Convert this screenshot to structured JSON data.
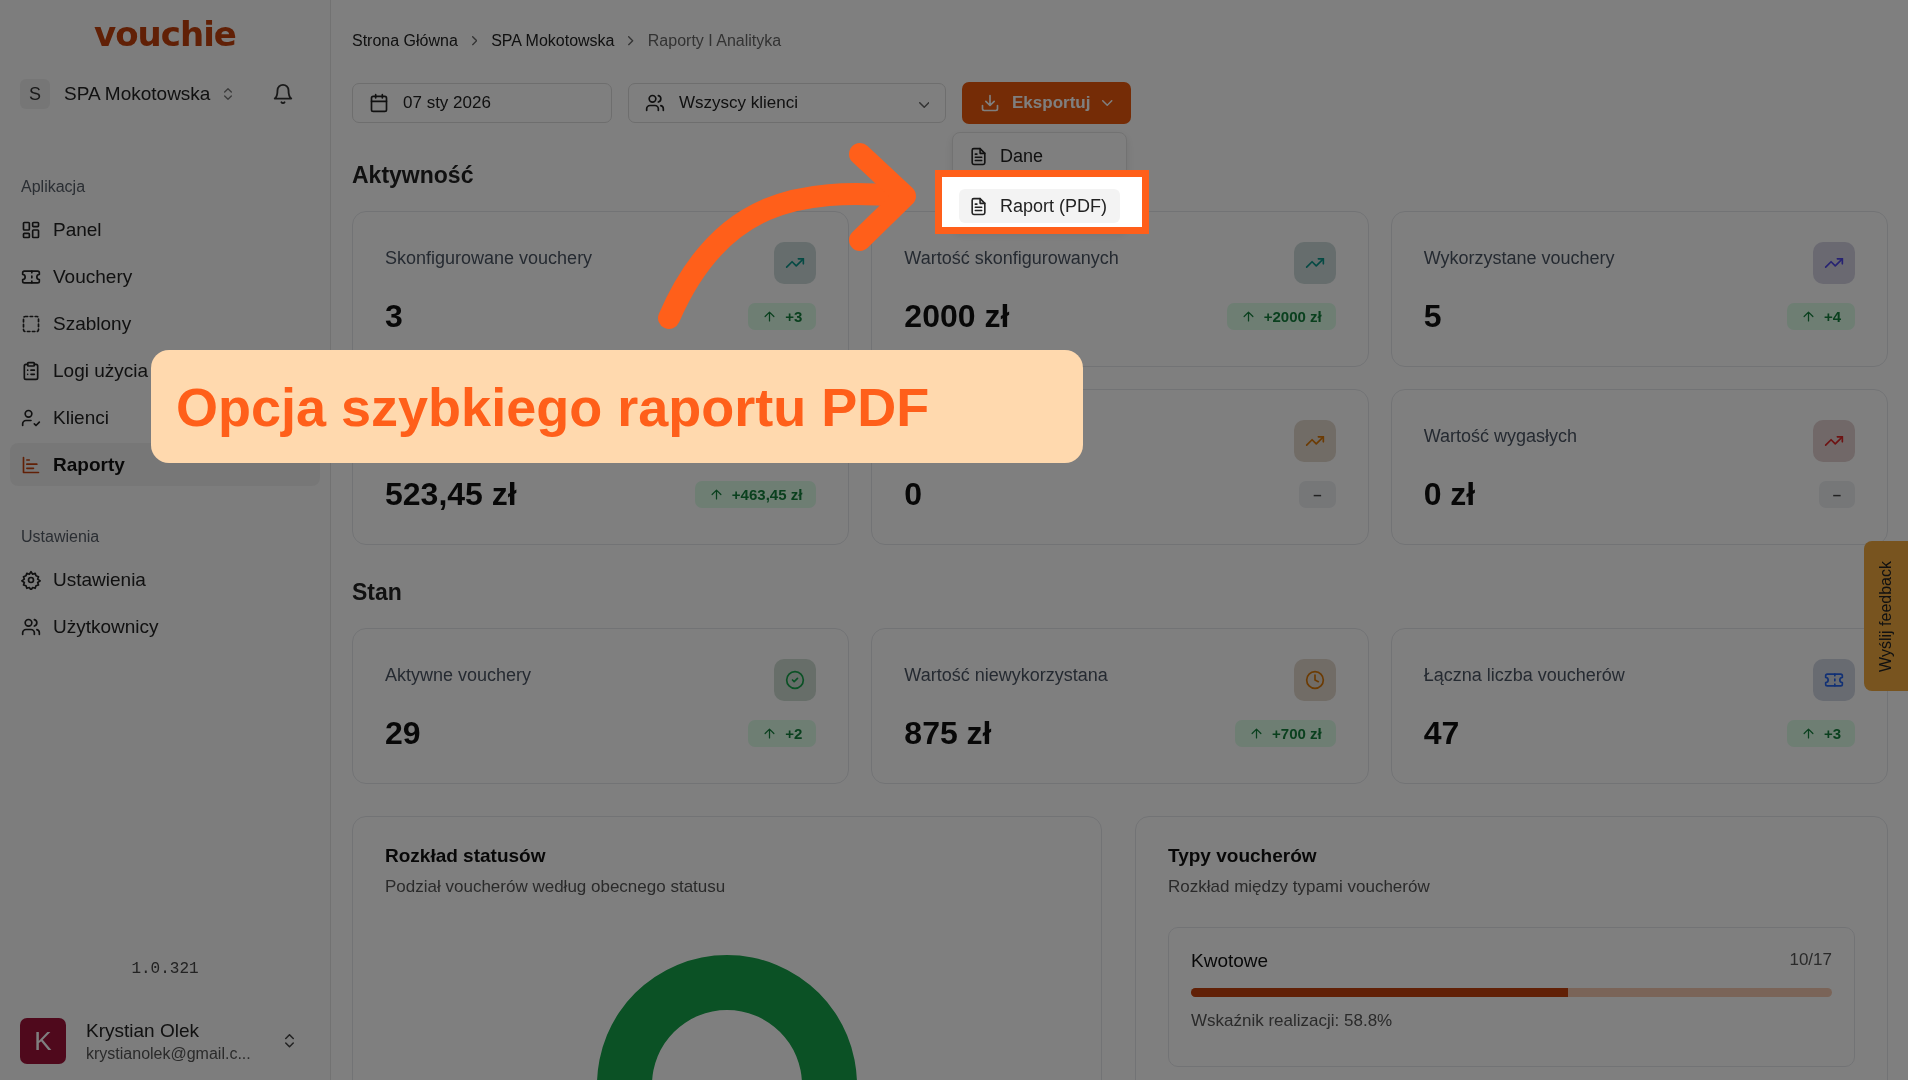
{
  "sidebar": {
    "logo": "vouchie",
    "workspace": {
      "initial": "S",
      "name": "SPA Mokotowska"
    },
    "sections": [
      {
        "title": "Aplikacja",
        "items": [
          {
            "label": "Panel",
            "kind": "grid",
            "selected": false
          },
          {
            "label": "Vouchery",
            "kind": "ticket",
            "selected": false
          },
          {
            "label": "Szablony",
            "kind": "template",
            "selected": false
          },
          {
            "label": "Logi użycia",
            "kind": "log",
            "selected": false
          },
          {
            "label": "Klienci",
            "kind": "client",
            "selected": false
          },
          {
            "label": "Raporty",
            "kind": "report",
            "selected": true
          }
        ]
      },
      {
        "title": "Ustawienia",
        "items": [
          {
            "label": "Ustawienia",
            "kind": "settings",
            "selected": false
          },
          {
            "label": "Użytkownicy",
            "kind": "users",
            "selected": false
          }
        ]
      }
    ],
    "version": "1.0.321",
    "user": {
      "initial": "K",
      "name": "Krystian Olek",
      "email": "krystianolek@gmail.c..."
    }
  },
  "breadcrumb": [
    "Strona Główna",
    "SPA Mokotowska",
    "Raporty I Analityka"
  ],
  "toolbar": {
    "date": "07 sty 2026",
    "clients": "Wszyscy klienci",
    "export": "Eksportuj",
    "export_menu": [
      {
        "label": "Dane",
        "highlighted": false
      },
      {
        "label": "Raport (PDF)",
        "highlighted": true
      }
    ]
  },
  "sections": [
    {
      "title": "Aktywność",
      "cards": [
        {
          "label": "Skonfigurowane vouchery",
          "value": "3",
          "kind": "trend",
          "color": "#064a44",
          "delta": {
            "text": "+3",
            "increase": true
          }
        },
        {
          "label": "Wartość skonfigurowanych",
          "value": "2000 zł",
          "kind": "trend",
          "color": "#064a44",
          "delta": {
            "text": "+2000 zł",
            "increase": true
          }
        },
        {
          "label": "Wykorzystane vouchery",
          "value": "5",
          "kind": "trend",
          "color": "#272372",
          "delta": {
            "text": "+4",
            "increase": true
          }
        },
        {
          "value": "523,45 zł",
          "delta": {
            "text": "+463,45 zł",
            "increase": true
          }
        },
        {
          "value": "0",
          "kind": "trend",
          "color": "#6c3b03",
          "delta": {
            "text": "–",
            "increase": false
          }
        },
        {
          "label": "Wartość wygasłych",
          "value": "0 zł",
          "kind": "trend",
          "color": "#6e1313",
          "delta": {
            "text": "–",
            "increase": false
          }
        }
      ]
    },
    {
      "title": "Stan",
      "cards": [
        {
          "label": "Aktywne vouchery",
          "value": "29",
          "kind": "check",
          "color": "#0b5125",
          "delta": {
            "text": "+2",
            "increase": true
          }
        },
        {
          "label": "Wartość niewykorzystana",
          "value": "875 zł",
          "kind": "clock",
          "color": "#6c3b03",
          "delta": {
            "text": "+700 zł",
            "increase": true
          }
        },
        {
          "label": "Łączna liczba voucherów",
          "value": "47",
          "kind": "ticket",
          "color": "#123175",
          "delta": {
            "text": "+3",
            "increase": true
          }
        }
      ]
    }
  ],
  "status_panel": {
    "title": "Rozkład statusów",
    "subtitle": "Podział voucherów według obecnego statusu"
  },
  "types_panel": {
    "title": "Typy voucherów",
    "subtitle": "Rozkład między typami voucherów",
    "items": [
      {
        "name": "Kwotowe",
        "count": "10/17",
        "level": 0.588,
        "caption": "Wskaźnik realizacji: 58.8%"
      }
    ]
  },
  "feedback": "Wyślij feedback",
  "callout": "Opcja szybkiego raportu PDF"
}
